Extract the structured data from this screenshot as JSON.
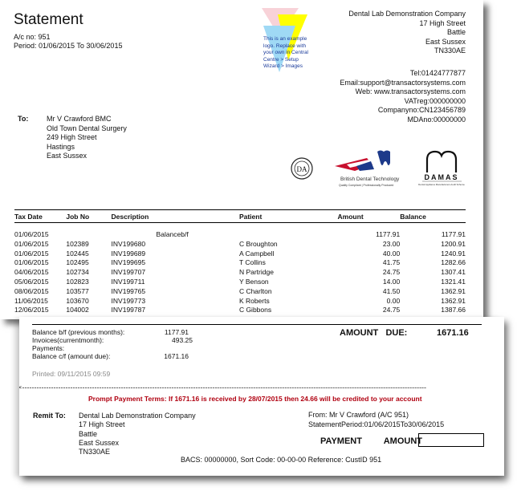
{
  "statement": {
    "title": "Statement",
    "account_line": "A/c no: 951",
    "period_line": "Period:  01/06/2015  To  30/06/2015"
  },
  "logo": {
    "icon": "example-logo-triangles",
    "text_lines": [
      "This is an example",
      "logo. Replace with",
      "your own in Central",
      "Centre > Setup",
      "Wizard > Images"
    ],
    "colors": {
      "pink": "#f8d2d8",
      "yellow": "#ffff00",
      "blue": "#9fd9f5"
    }
  },
  "company": {
    "lines": [
      "Dental Lab Demonstration Company",
      "17 High Street",
      "Battle",
      "East Sussex",
      "TN330AE"
    ],
    "contact": [
      "Tel:01424777877",
      "Email:support@transactorsystems.com",
      "Web: www.transactorsystems.com",
      "VATreg:000000000",
      "Companyno:CN123456789",
      "MDAno:00000000"
    ]
  },
  "to": {
    "label": "To:",
    "lines": [
      "Mr V Crawford BMC",
      "Old Town Dental Surgery",
      "249 High Street",
      "Hastings",
      "East Sussex"
    ]
  },
  "badges": [
    {
      "name": "dla-seal",
      "text": "DLA"
    },
    {
      "name": "british-dental-technology",
      "text": "British Dental Technology",
      "sub": "Quality Compliant | Professionally Produced"
    },
    {
      "name": "damas",
      "text": "DAMAS",
      "sub": "Dental Appliance Manufacturers Audit Scheme"
    }
  ],
  "table": {
    "headers": [
      "Tax Date",
      "Job No",
      "Description",
      "Patient",
      "Amount",
      "Balance"
    ],
    "rows": [
      {
        "date": "01/06/2015",
        "job": "",
        "desc": "Balanceb/f",
        "patient": "",
        "amount": "1177.91",
        "balance": "1177.91"
      },
      {
        "date": "01/06/2015",
        "job": "102389",
        "desc": "INV199680",
        "patient": "C Broughton",
        "amount": "23.00",
        "balance": "1200.91"
      },
      {
        "date": "01/06/2015",
        "job": "102445",
        "desc": "INV199689",
        "patient": "A Campbell",
        "amount": "40.00",
        "balance": "1240.91"
      },
      {
        "date": "01/06/2015",
        "job": "102495",
        "desc": "INV199695",
        "patient": "T Collins",
        "amount": "41.75",
        "balance": "1282.66"
      },
      {
        "date": "04/06/2015",
        "job": "102734",
        "desc": "INV199707",
        "patient": "N Partridge",
        "amount": "24.75",
        "balance": "1307.41"
      },
      {
        "date": "05/06/2015",
        "job": "102823",
        "desc": "INV199711",
        "patient": "Y Benson",
        "amount": "14.00",
        "balance": "1321.41"
      },
      {
        "date": "08/06/2015",
        "job": "103577",
        "desc": "INV199765",
        "patient": "C Charlton",
        "amount": "41.50",
        "balance": "1362.91"
      },
      {
        "date": "11/06/2015",
        "job": "103670",
        "desc": "INV199773",
        "patient": "K Roberts",
        "amount": "0.00",
        "balance": "1362.91"
      },
      {
        "date": "12/06/2015",
        "job": "104002",
        "desc": "INV199787",
        "patient": "C Gibbons",
        "amount": "24.75",
        "balance": "1387.66"
      }
    ]
  },
  "summary": {
    "rows": [
      {
        "label": "Balance b/f (previous months):",
        "value": "1177.91"
      },
      {
        "label": "Invoices(currentmonth):",
        "value": "493.25"
      },
      {
        "label": "Payments:",
        "value": ""
      },
      {
        "label": "Balance c/f (amount due):",
        "value": "1671.16"
      }
    ],
    "printed": "Printed: 09/11/2015 09:59",
    "amount_due_label": "AMOUNT   DUE:",
    "amount_due_value": "1671.16"
  },
  "remittance": {
    "scissors_icon": "✂",
    "prompt_terms": "Prompt Payment Terms: If  1671.16 is received by 28/07/2015 then 24.66 will be credited to your account",
    "remit_label": "Remit To:",
    "remit_lines": [
      "Dental Lab Demonstration Company",
      "17 High Street",
      "Battle",
      "East Sussex",
      "TN330AE"
    ],
    "from_line": "From: Mr V Crawford (A/C 951)",
    "statement_period_line": "StatementPeriod:01/06/2015To30/06/2015",
    "payment_amount_label": "PAYMENT   AMOUNT",
    "payment_amount_value": "",
    "bacs_line": "BACS: 00000000, Sort Code: 00-00-00 Reference: CustID 951"
  }
}
